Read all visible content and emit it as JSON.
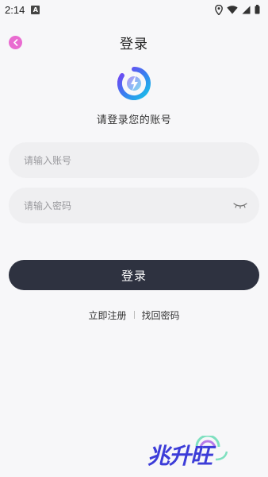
{
  "status_bar": {
    "time": "2:14",
    "notification_icon": "A"
  },
  "header": {
    "title": "登录",
    "back_icon": "chevron-left-icon"
  },
  "branding": {
    "subtitle": "请登录您的账号"
  },
  "form": {
    "account_placeholder": "请输入账号",
    "password_placeholder": "请输入密码",
    "submit_label": "登录"
  },
  "links": {
    "register": "立即注册",
    "recover": "找回密码"
  },
  "watermark": {
    "text": "兆升旺"
  },
  "colors": {
    "back_button": "#e96bd0",
    "primary_button": "#2e3240",
    "input_bg": "#efeff1",
    "page_bg": "#f7f7f9"
  }
}
